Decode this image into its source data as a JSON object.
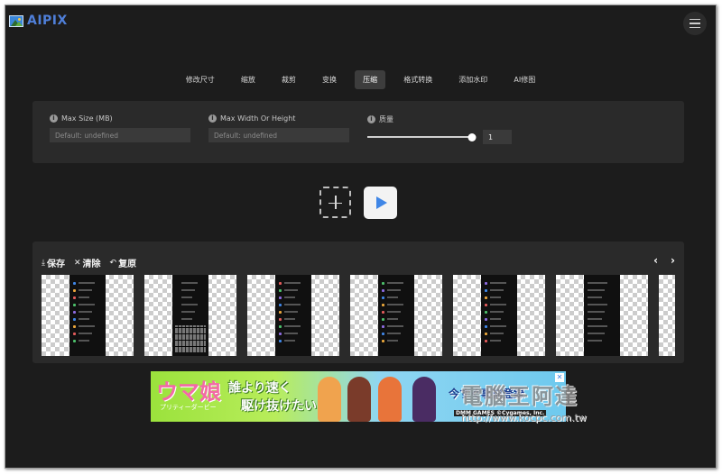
{
  "app": {
    "name": "AIPIX"
  },
  "tabs": [
    {
      "label": "修改尺寸"
    },
    {
      "label": "缩放"
    },
    {
      "label": "裁剪"
    },
    {
      "label": "变换"
    },
    {
      "label": "压缩",
      "active": true
    },
    {
      "label": "格式转换"
    },
    {
      "label": "添加水印"
    },
    {
      "label": "AI修图"
    }
  ],
  "settings": {
    "max_size": {
      "label": "Max Size (MB)",
      "placeholder": "Default: undefined"
    },
    "max_dim": {
      "label": "Max Width Or Height",
      "placeholder": "Default: undefined"
    },
    "quality": {
      "label": "质量",
      "value": "1",
      "fraction": 1.0
    }
  },
  "gallery": {
    "actions": [
      {
        "icon": "⤓",
        "label": "保存"
      },
      {
        "icon": "✕",
        "label": "清除"
      },
      {
        "icon": "↶",
        "label": "复原"
      }
    ],
    "nav": {
      "prev": "‹",
      "next": "›"
    },
    "thumbnail_count": 7
  },
  "ad": {
    "logo": "ウマ娘",
    "subtitle": "プリティーダービー",
    "line1": "誰より速く",
    "line2": "駆け抜けたい!",
    "right_text": "今すぐ事前登録",
    "brand": "DMM GAMES ©Cygames, Inc.",
    "close": "✕"
  },
  "watermark": {
    "title": "電腦王阿達",
    "url": "http://www.kocpc.com.tw"
  },
  "colors": {
    "background": "#1c1c1c",
    "panel": "#2a2a2a",
    "accent": "#3f86e6",
    "logo": "#4f7fd9"
  }
}
